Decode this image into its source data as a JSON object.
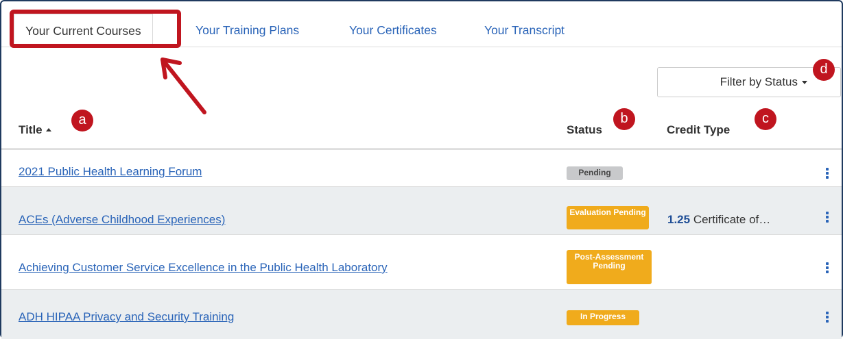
{
  "tabs": [
    {
      "label": "Your Current Courses",
      "active": true
    },
    {
      "label": "Your Training Plans",
      "active": false
    },
    {
      "label": "Your Certificates",
      "active": false
    },
    {
      "label": "Your Transcript",
      "active": false
    }
  ],
  "filter": {
    "label": "Filter by Status"
  },
  "annotations": {
    "a": "a",
    "b": "b",
    "c": "c",
    "d": "d"
  },
  "table": {
    "headers": {
      "title": "Title",
      "status": "Status",
      "credit": "Credit Type"
    },
    "rows": [
      {
        "title": "2021 Public Health Learning Forum",
        "status": "Pending",
        "credit_value": "",
        "credit_text": ""
      },
      {
        "title": "ACEs (Adverse Childhood Experiences)",
        "status": "Evaluation Pending",
        "credit_value": "1.25",
        "credit_text": "Certificate of…"
      },
      {
        "title": "Achieving Customer Service Excellence in the Public Health Laboratory",
        "status": "Post-Assessment Pending",
        "credit_value": "",
        "credit_text": ""
      },
      {
        "title": "ADH HIPAA Privacy and Security Training",
        "status": "In Progress",
        "credit_value": "",
        "credit_text": ""
      }
    ]
  },
  "colors": {
    "accent": "#2a64b8",
    "annotation": "#c0151f",
    "status_warning": "#f0ab1c",
    "status_neutral": "#c8c9cb"
  }
}
